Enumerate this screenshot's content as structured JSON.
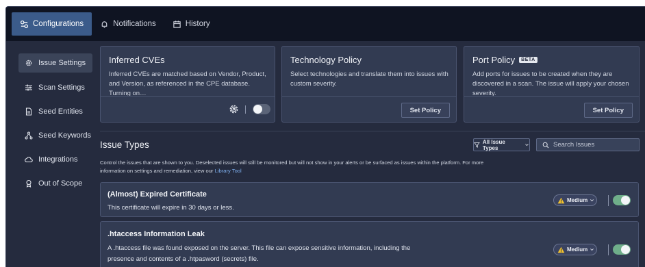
{
  "nav": {
    "tabs": [
      {
        "label": "Configurations",
        "icon": "configurations-icon",
        "active": true
      },
      {
        "label": "Notifications",
        "icon": "bell-icon",
        "active": false
      },
      {
        "label": "History",
        "icon": "calendar-icon",
        "active": false
      }
    ]
  },
  "sidebar": {
    "items": [
      {
        "label": "Issue Settings",
        "icon": "gear-icon",
        "active": true
      },
      {
        "label": "Scan Settings",
        "icon": "sliders-icon",
        "active": false
      },
      {
        "label": "Seed Entities",
        "icon": "document-icon",
        "active": false
      },
      {
        "label": "Seed Keywords",
        "icon": "network-icon",
        "active": false
      },
      {
        "label": "Integrations",
        "icon": "cloud-icon",
        "active": false
      },
      {
        "label": "Out of Scope",
        "icon": "badge-icon",
        "active": false
      }
    ]
  },
  "cards": {
    "inferred": {
      "title": "Inferred CVEs",
      "description": "Inferred CVEs are matched based on Vendor, Product, and Version, as referenced in the CPE database. Turning on…",
      "toggle_on": false
    },
    "technology": {
      "title": "Technology Policy",
      "description": "Select technologies and translate them into issues with custom severity.",
      "button": "Set Policy"
    },
    "port": {
      "title": "Port Policy",
      "badge": "BETA",
      "description": "Add ports for issues to be created when they are discovered in a scan. The issue will apply your chosen severity.",
      "button": "Set Policy"
    }
  },
  "issue_types": {
    "title": "Issue Types",
    "filter_label": "All Issue Types",
    "search_placeholder": "Search Issues",
    "description": "Control the issues that are shown to you. Deselected issues will still be monitored but will not show in your alerts or be surfaced as issues within the platform. For more information on settings and remediation, view our",
    "library_link": "Library Tool",
    "rows": [
      {
        "title": "(Almost) Expired Certificate",
        "description": "This certificate will expire in 30 days or less.",
        "severity": "Medium",
        "enabled": true
      },
      {
        "title": ".htaccess Information Leak",
        "description": "A .htaccess file was found exposed on the server. This file can expose sensitive information, including the presence and contents of a .htpasword (secrets) file.",
        "severity": "Medium",
        "enabled": true
      }
    ]
  },
  "colors": {
    "active_tab": "#3b5b8a",
    "toggle_on": "#6fae8a",
    "warning": "#f2c230",
    "link": "#7fb0ef"
  }
}
